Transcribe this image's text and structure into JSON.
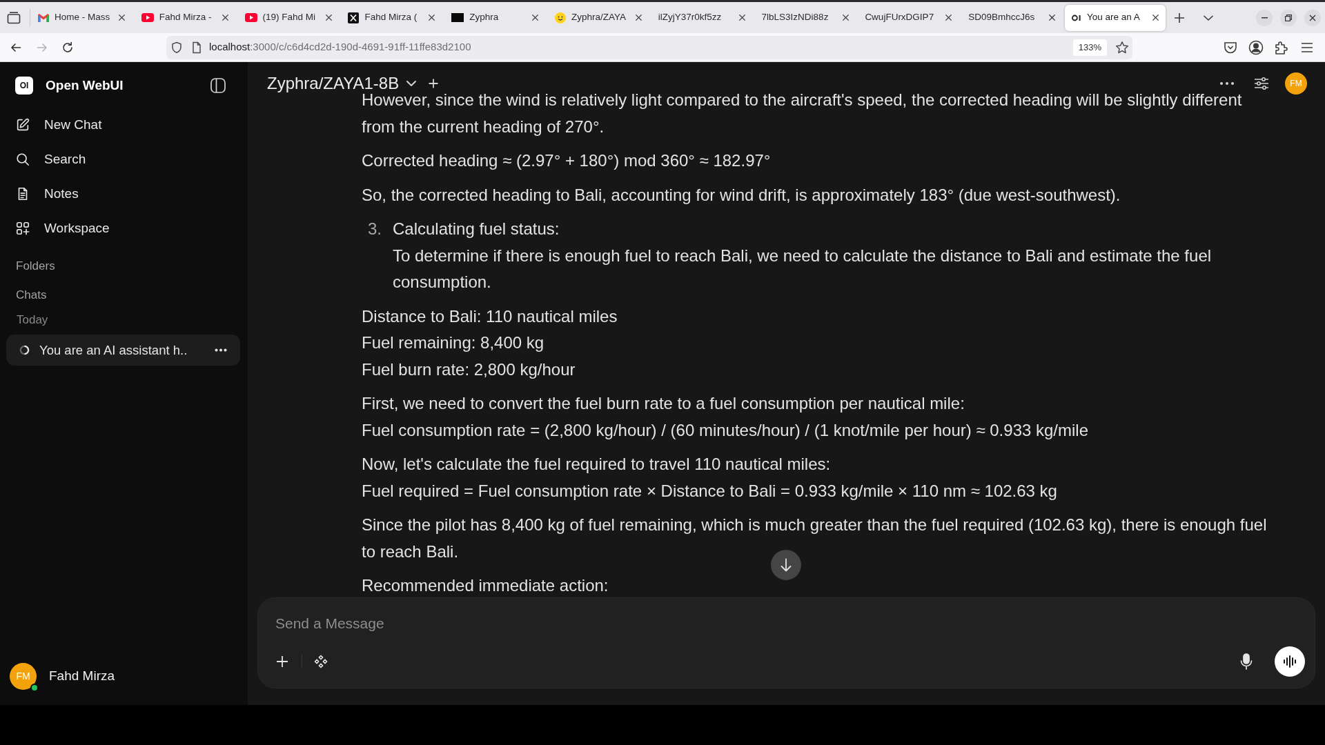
{
  "browser": {
    "tabs": [
      {
        "kind": "mail",
        "title": "Home - Mass",
        "selected": false
      },
      {
        "kind": "video",
        "title": "Fahd Mirza -",
        "selected": false
      },
      {
        "kind": "video",
        "title": "(19) Fahd Mi",
        "selected": false
      },
      {
        "kind": "x",
        "title": "Fahd Mirza (",
        "selected": false
      },
      {
        "kind": "block",
        "title": "Zyphra",
        "selected": false
      },
      {
        "kind": "emoji",
        "title": "Zyphra/ZAYA",
        "selected": false
      },
      {
        "kind": "plain",
        "title": "ilZyjY37r0kf5zz",
        "selected": false
      },
      {
        "kind": "plain",
        "title": "7lbLS3IzNDi88z",
        "selected": false
      },
      {
        "kind": "plain",
        "title": "CwujFUrxDGIP7",
        "selected": false
      },
      {
        "kind": "plain",
        "title": "SD09BmhccJ6s",
        "selected": false
      },
      {
        "kind": "webui",
        "title": "You are an A",
        "selected": true
      }
    ],
    "navigation": [
      {
        "kind": "back",
        "disabled": false
      },
      {
        "kind": "forward",
        "disabled": true
      },
      {
        "kind": "reload",
        "disabled": false
      }
    ],
    "address": {
      "host": "localhost",
      "path": ":3000/c/c6d4cd2d-190d-4691-91ff-11ffe83d2100"
    },
    "zoom": "133%"
  },
  "sidebar": {
    "logo_text": "OI",
    "app_name": "Open WebUI",
    "nav": [
      {
        "kind": "compose",
        "label": "New Chat"
      },
      {
        "kind": "search",
        "label": "Search"
      },
      {
        "kind": "notes",
        "label": "Notes"
      },
      {
        "kind": "workspace",
        "label": "Workspace"
      }
    ],
    "folders_label": "Folders",
    "chats_label": "Chats",
    "groups": [
      {
        "label": "Today",
        "chats": [
          {
            "title": "You are an AI assistant h..",
            "selected": true
          }
        ]
      }
    ],
    "user": {
      "initials": "FM",
      "name": "Fahd Mirza",
      "online": true
    }
  },
  "chat": {
    "model": "Zyphra/ZAYA1-8B",
    "user_initials": "FM",
    "response": [
      {
        "kind": "paragraph",
        "lines": [
          "However, since the wind is relatively light compared to the aircraft's speed, the corrected heading will be slightly different from the current heading of 270°."
        ]
      },
      {
        "kind": "paragraph",
        "lines": [
          "Corrected heading ≈ (2.97° + 180°) mod 360° ≈ 182.97°"
        ]
      },
      {
        "kind": "paragraph",
        "lines": [
          "So, the corrected heading to Bali, accounting for wind drift, is approximately 183° (due west-southwest)."
        ]
      },
      {
        "kind": "list_item",
        "number": "3.",
        "title": "Calculating fuel status:",
        "text": "To determine if there is enough fuel to reach Bali, we need to calculate the distance to Bali and estimate the fuel consumption."
      },
      {
        "kind": "paragraph",
        "lines": [
          "Distance to Bali: 110 nautical miles",
          "Fuel remaining: 8,400 kg",
          "Fuel burn rate: 2,800 kg/hour"
        ]
      },
      {
        "kind": "paragraph",
        "lines": [
          "First, we need to convert the fuel burn rate to a fuel consumption per nautical mile:",
          "Fuel consumption rate = (2,800 kg/hour) / (60 minutes/hour) / (1 knot/mile per hour) ≈ 0.933 kg/mile"
        ]
      },
      {
        "kind": "paragraph",
        "lines": [
          "Now, let's calculate the fuel required to travel 110 nautical miles:",
          "Fuel required = Fuel consumption rate × Distance to Bali = 0.933 kg/mile × 110 nm ≈ 102.63 kg"
        ]
      },
      {
        "kind": "paragraph",
        "lines": [
          "Since the pilot has 8,400 kg of fuel remaining, which is much greater than the fuel required (102.63 kg), there is enough fuel to reach Bali."
        ]
      },
      {
        "kind": "paragraph",
        "lines": [
          "Recommended immediate action:"
        ]
      }
    ],
    "composer": {
      "placeholder": "Send a Message"
    }
  }
}
